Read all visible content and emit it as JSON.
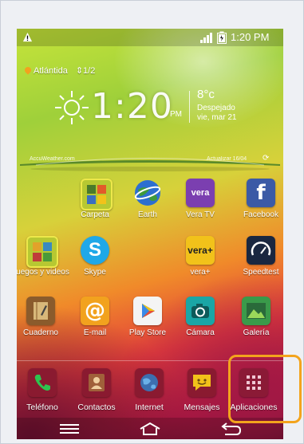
{
  "status_bar": {
    "time": "1:20 PM"
  },
  "location": {
    "city": "Atlántida",
    "page_indicator": "1/2"
  },
  "weather": {
    "time": "1:20",
    "ampm": "PM",
    "temperature": "8°c",
    "condition": "Despejado",
    "date": "vie, mar 21",
    "source": "AccuWeather.com",
    "updated": "Actualizar 16/04"
  },
  "apps": [
    {
      "label": "Carpeta",
      "icon": "folder-icon",
      "color": "#b7c832"
    },
    {
      "label": "Earth",
      "icon": "earth-icon",
      "color": "#2d6fd0"
    },
    {
      "label": "Vera TV",
      "icon": "veratv-icon",
      "color": "#7b3fb0"
    },
    {
      "label": "Facebook",
      "icon": "facebook-icon",
      "color": "#3b5aa6"
    },
    {
      "label": "Juegos y videos",
      "icon": "games-folder-icon",
      "color": "#b7c832"
    },
    {
      "label": "Skype",
      "icon": "skype-icon",
      "color": "#1fa8e8"
    },
    {
      "label": "vera+",
      "icon": "veraplus-icon",
      "color": "#f2c21a"
    },
    {
      "label": "Speedtest",
      "icon": "speedtest-icon",
      "color": "#1a2740"
    },
    {
      "label": "Cuaderno",
      "icon": "notebook-icon",
      "color": "#8a5b2c"
    },
    {
      "label": "E-mail",
      "icon": "email-icon",
      "color": "#f2a21e"
    },
    {
      "label": "Play Store",
      "icon": "playstore-icon",
      "color": "#f4f4f4"
    },
    {
      "label": "Cámara",
      "icon": "camera-icon",
      "color": "#1aa6a6"
    },
    {
      "label": "Galería",
      "icon": "gallery-icon",
      "color": "#3a9a4a"
    }
  ],
  "dock": [
    {
      "label": "Teléfono",
      "icon": "phone-icon",
      "color": "#2ea44f"
    },
    {
      "label": "Contactos",
      "icon": "contacts-icon",
      "color": "#a0603a"
    },
    {
      "label": "Internet",
      "icon": "internet-icon",
      "color": "#3c6fb0"
    },
    {
      "label": "Mensajes",
      "icon": "messages-icon",
      "color": "#f2c21a"
    },
    {
      "label": "Aplicaciones",
      "icon": "apps-grid-icon",
      "color": "#8b1a36"
    }
  ],
  "accent_color": "#f3a41d"
}
